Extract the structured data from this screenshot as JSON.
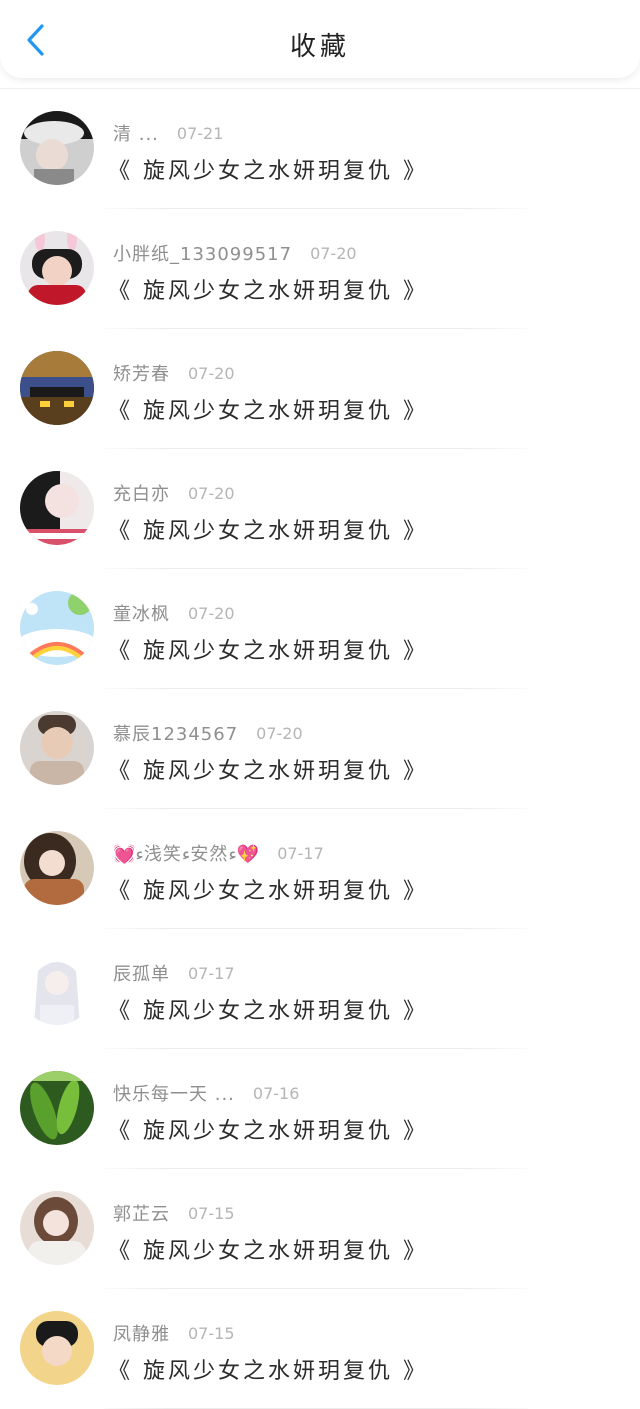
{
  "header": {
    "title": "收藏"
  },
  "items": [
    {
      "username": "清 ...",
      "date": "07-21",
      "novel": "《 旋风少女之水妍玥复仇 》"
    },
    {
      "username": "小胖纸_133099517",
      "date": "07-20",
      "novel": "《 旋风少女之水妍玥复仇 》"
    },
    {
      "username": "矫芳春",
      "date": "07-20",
      "novel": "《 旋风少女之水妍玥复仇 》"
    },
    {
      "username": "充白亦",
      "date": "07-20",
      "novel": "《 旋风少女之水妍玥复仇 》"
    },
    {
      "username": "童冰枫",
      "date": "07-20",
      "novel": "《 旋风少女之水妍玥复仇 》"
    },
    {
      "username": "慕辰1234567",
      "date": "07-20",
      "novel": "《 旋风少女之水妍玥复仇 》"
    },
    {
      "username": "💓ء浅笑ء安然ء💖",
      "date": "07-17",
      "novel": "《 旋风少女之水妍玥复仇 》"
    },
    {
      "username": "辰孤单",
      "date": "07-17",
      "novel": "《 旋风少女之水妍玥复仇 》"
    },
    {
      "username": "快乐每一天 ...",
      "date": "07-16",
      "novel": "《 旋风少女之水妍玥复仇 》"
    },
    {
      "username": "郭芷云",
      "date": "07-15",
      "novel": "《 旋风少女之水妍玥复仇 》"
    },
    {
      "username": "凤静雅",
      "date": "07-15",
      "novel": "《 旋风少女之水妍玥复仇 》"
    }
  ],
  "colors": {
    "accent": "#2196F3",
    "title": "#222222",
    "username": "#8f8f8f",
    "date": "#b5b5b5"
  }
}
